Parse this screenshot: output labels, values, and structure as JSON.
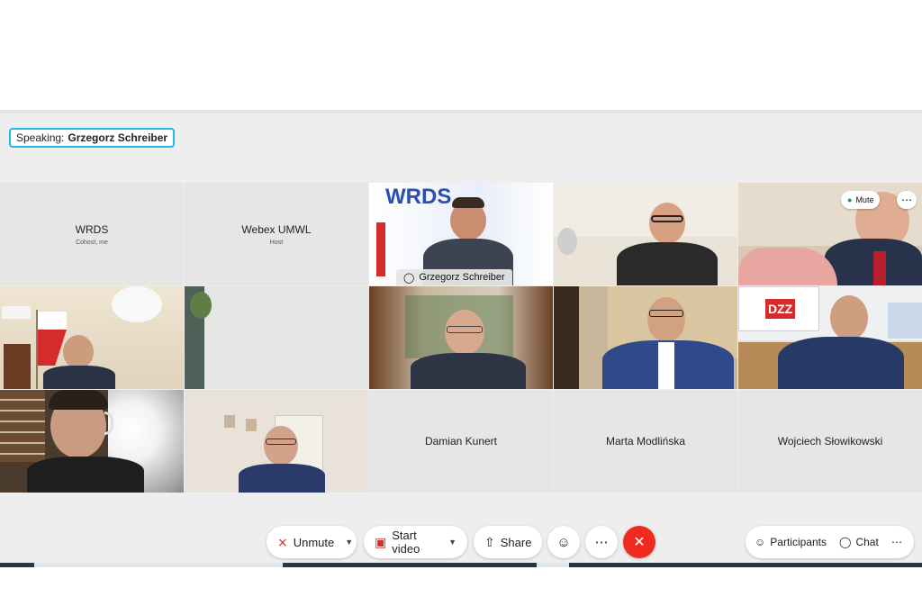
{
  "speaking": {
    "label": "Speaking:",
    "name": "Grzegorz Schreiber"
  },
  "tiles": [
    {
      "name": "WRDS",
      "role": "Cohost, me"
    },
    {
      "name": "Webex UMWL",
      "role": "Host"
    },
    {
      "name": "Grzegorz Schreiber",
      "logo_text": "WRDS"
    },
    {
      "name": ""
    },
    {
      "name": "",
      "mute_label": "Mute"
    },
    {
      "name": ""
    },
    {
      "name": ""
    },
    {
      "name": ""
    },
    {
      "name": ""
    },
    {
      "name": "",
      "sign_text": "DZZ"
    },
    {
      "name": ""
    },
    {
      "name": ""
    },
    {
      "name": "Damian Kunert"
    },
    {
      "name": "Marta Modlińska"
    },
    {
      "name": "Wojciech Słowikowski"
    }
  ],
  "controls": {
    "unmute_label": "Unmute",
    "start_video_label": "Start video",
    "share_label": "Share",
    "participants_label": "Participants",
    "chat_label": "Chat",
    "more_glyph": "⋯",
    "end_glyph": "✕",
    "emoji_glyph": "☺"
  },
  "colors": {
    "accent": "#29b6e8",
    "end_call": "#ef2b1f",
    "bottom_bar": "#1e3a4a"
  }
}
